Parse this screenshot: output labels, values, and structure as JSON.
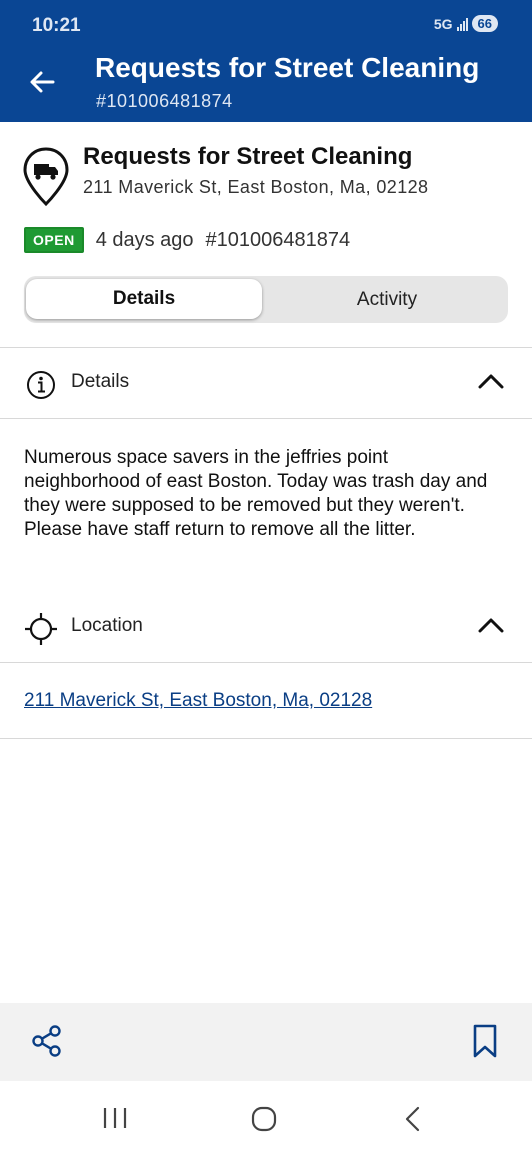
{
  "status_bar": {
    "time": "10:21",
    "network": "5G",
    "battery": "66"
  },
  "header": {
    "back_icon": "arrow-left-icon",
    "title": "Requests for Street Cleaning",
    "case_number": "#101006481874",
    "background_color": "#0a4694"
  },
  "request": {
    "icon": "truck-map-pin-icon",
    "title": "Requests for Street Cleaning",
    "address": "211 Maverick St, East Boston, Ma, 02128",
    "status": "OPEN",
    "status_color": "#1f9a33",
    "age": "4 days ago",
    "case_number": "#101006481874"
  },
  "tabs": [
    {
      "label": "Details",
      "selected": true
    },
    {
      "label": "Activity",
      "selected": false
    }
  ],
  "details_section": {
    "icon": "info-icon",
    "label": "Details",
    "expanded": true,
    "description": "Numerous space savers in the jeffries point neighborhood of east Boston. Today was trash day and they were supposed to be removed but they weren't. Please have staff return to remove all the litter."
  },
  "location_section": {
    "icon": "crosshair-icon",
    "label": "Location",
    "expanded": true,
    "address_link": "211 Maverick St, East Boston, Ma, 02128"
  },
  "bottom_actions": {
    "share_icon": "share-icon",
    "bookmark_icon": "bookmark-icon"
  },
  "system_nav": {
    "recent_icon": "recent-apps-icon",
    "home_icon": "home-icon",
    "back_icon": "back-chevron-icon"
  }
}
